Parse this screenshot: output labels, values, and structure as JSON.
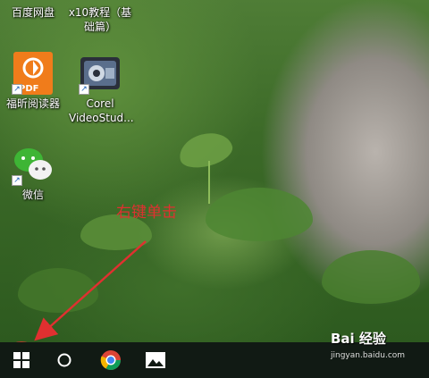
{
  "desktop": {
    "icons": [
      {
        "label": "百度网盘",
        "icon": "baidu-netdisk-icon"
      },
      {
        "label": "x10教程（基础篇）",
        "icon": "document-icon"
      },
      {
        "label": "福昕阅读器",
        "icon": "foxit-pdf-icon"
      },
      {
        "label": "Corel VideoStud...",
        "icon": "corel-videostudio-icon"
      },
      {
        "label": "微信",
        "icon": "wechat-icon"
      }
    ]
  },
  "annotation": {
    "text": "右键单击",
    "color": "#e03030"
  },
  "taskbar": {
    "items": [
      {
        "name": "start-button",
        "icon": "windows-logo-icon"
      },
      {
        "name": "search-button",
        "icon": "cortana-circle-icon"
      },
      {
        "name": "chrome-button",
        "icon": "chrome-icon"
      },
      {
        "name": "photos-button",
        "icon": "photos-icon"
      }
    ]
  },
  "watermark": {
    "brand": "Bai 经验",
    "url": "jingyan.baidu.com"
  }
}
